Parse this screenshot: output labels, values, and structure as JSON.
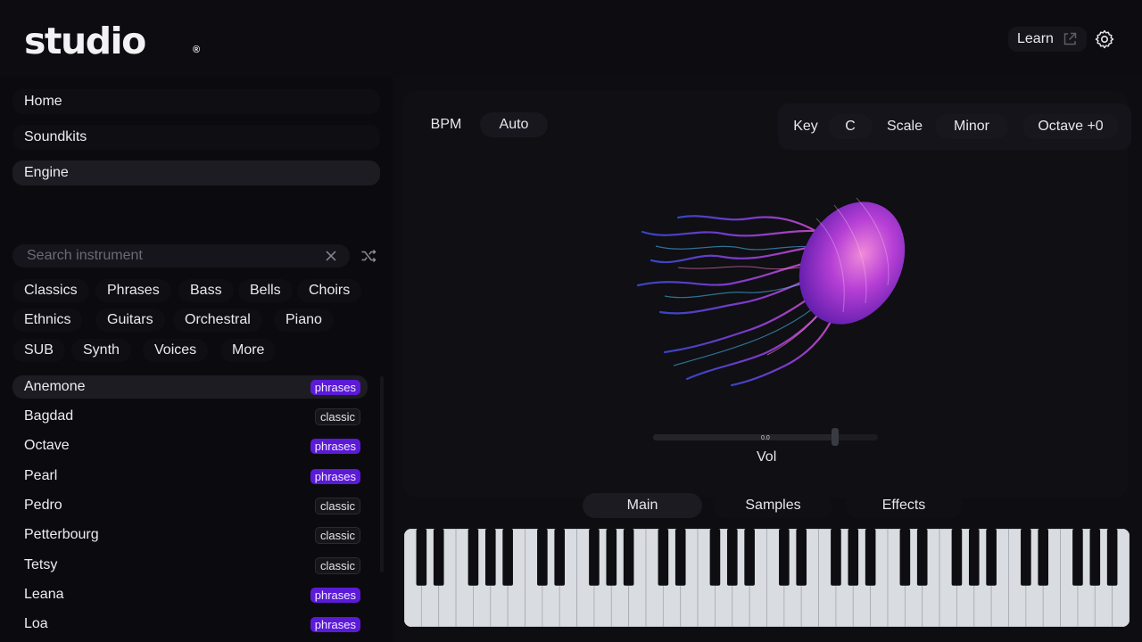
{
  "header": {
    "logo": "studio",
    "logo_mark": "®",
    "learn_label": "Learn",
    "icons": {
      "external": "external-link-icon",
      "settings": "gear-icon"
    }
  },
  "nav": {
    "items": [
      {
        "label": "Home"
      },
      {
        "label": "Soundkits"
      },
      {
        "label": "Engine",
        "active": true
      }
    ]
  },
  "search": {
    "placeholder": "Search instrument"
  },
  "categories": [
    "Classics",
    "Phrases",
    "Bass",
    "Bells",
    "Choirs",
    "Ethnics",
    "Guitars",
    "Orchestral",
    "Piano",
    "SUB",
    "Synth",
    "Voices",
    "More"
  ],
  "instruments": [
    {
      "name": "Anemone",
      "tag": "phrases",
      "selected": true
    },
    {
      "name": "Bagdad",
      "tag": "classic"
    },
    {
      "name": "Octave",
      "tag": "phrases"
    },
    {
      "name": "Pearl",
      "tag": "phrases"
    },
    {
      "name": "Pedro",
      "tag": "classic"
    },
    {
      "name": "Petterbourg",
      "tag": "classic"
    },
    {
      "name": "Tetsy",
      "tag": "classic"
    },
    {
      "name": "Leana",
      "tag": "phrases"
    },
    {
      "name": "Loa",
      "tag": "phrases"
    }
  ],
  "controls": {
    "bpm_label": "BPM",
    "bpm_value": "Auto",
    "key_label": "Key",
    "key_value": "C",
    "scale_label": "Scale",
    "scale_value": "Minor",
    "octave_value": "Octave +0"
  },
  "volume": {
    "label": "Vol",
    "value_text": "0.0",
    "level": 0.81
  },
  "tabs": [
    {
      "label": "Main",
      "active": true
    },
    {
      "label": "Samples"
    },
    {
      "label": "Effects"
    }
  ],
  "colors": {
    "accent_purple": "#5b1ad8",
    "background": "#0b0b0f",
    "panel": "#0f0f14"
  }
}
